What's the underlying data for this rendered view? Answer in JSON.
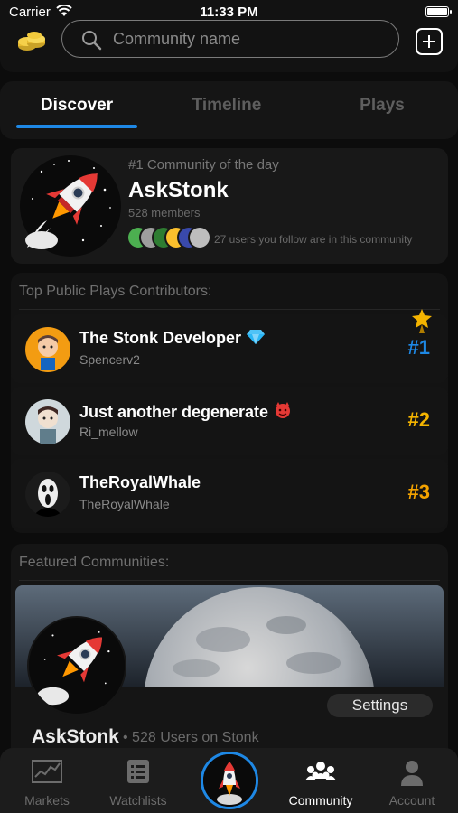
{
  "status_bar": {
    "carrier": "Carrier",
    "time": "11:33 PM"
  },
  "header": {
    "search_placeholder": "Community name"
  },
  "tabs": [
    {
      "label": "Discover",
      "active": true
    },
    {
      "label": "Timeline",
      "active": false
    },
    {
      "label": "Plays",
      "active": false
    }
  ],
  "community_of_day": {
    "kicker": "#1 Community of the day",
    "name": "AskStonk",
    "members": "528 members",
    "follow_text": "27 users you follow are in this community"
  },
  "contributors": {
    "heading": "Top Public Plays Contributors:",
    "rows": [
      {
        "name": "The Stonk Developer",
        "handle": "Spencerv2",
        "rank": "#1",
        "rank_color": "#1e88e5",
        "badge": "gem-icon"
      },
      {
        "name": "Just another degenerate",
        "handle": "Ri_mellow",
        "rank": "#2",
        "rank_color": "#f4b400",
        "badge": "devil-icon"
      },
      {
        "name": "TheRoyalWhale",
        "handle": "TheRoyalWhale",
        "rank": "#3",
        "rank_color": "#f4a300",
        "badge": ""
      }
    ]
  },
  "featured": {
    "heading": "Featured Communities:",
    "settings_label": "Settings",
    "name": "AskStonk",
    "subtitle": "• 528 Users on Stonk"
  },
  "tabbar": {
    "markets": "Markets",
    "watchlists": "Watchlists",
    "community": "Community",
    "account": "Account"
  },
  "colors": {
    "accent": "#1e88e5",
    "gold": "#f4b400",
    "background": "#0c0c0c"
  }
}
